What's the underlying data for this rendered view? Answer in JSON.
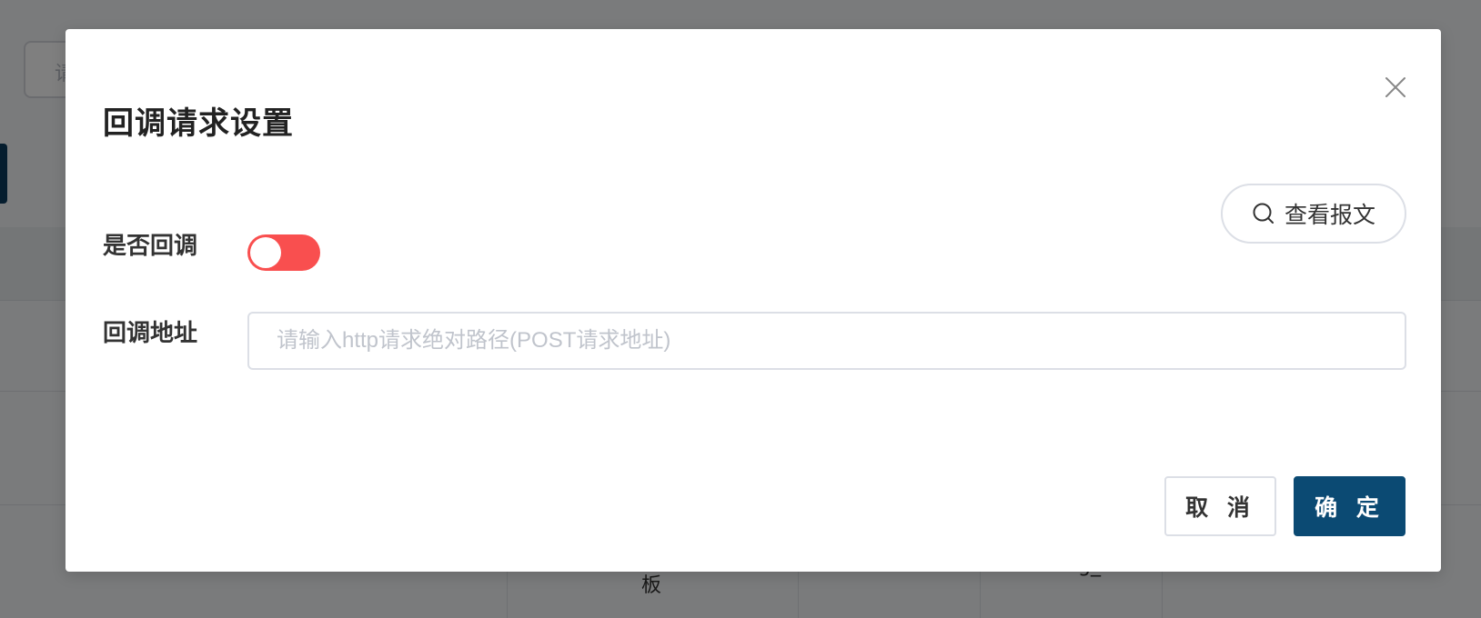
{
  "background": {
    "search_hint": "请",
    "cell_text": "板",
    "cell_text_2": "g_"
  },
  "modal": {
    "title": "回调请求设置",
    "close_icon": "close-icon",
    "view_message_button": {
      "label": "查看报文",
      "icon": "search-icon"
    },
    "callback_toggle": {
      "label": "是否回调",
      "enabled": false,
      "color": "#f94f4f"
    },
    "callback_url": {
      "label": "回调地址",
      "value": "",
      "placeholder": "请输入http请求绝对路径(POST请求地址)"
    },
    "footer": {
      "cancel_label": "取 消",
      "confirm_label": "确 定",
      "confirm_color": "#0b4a73"
    }
  }
}
